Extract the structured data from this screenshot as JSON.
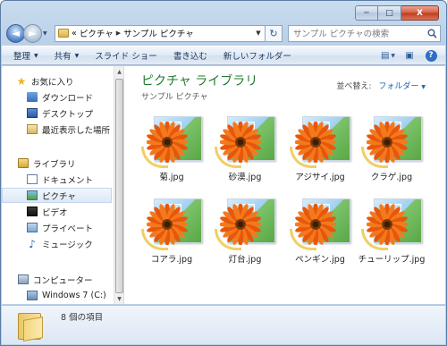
{
  "window": {
    "caption_min": "─",
    "caption_max": "□",
    "caption_close": "X"
  },
  "nav": {
    "back_icon": "left-arrow-icon",
    "forward_icon": "right-arrow-icon",
    "breadcrumb": [
      "«",
      "ピクチャ",
      "サンプル ピクチャ"
    ],
    "search_placeholder": "サンプル ピクチャの検索"
  },
  "toolbar": {
    "organize": "整理",
    "share": "共有",
    "slideshow": "スライド ショー",
    "burn": "書き込む",
    "new_folder": "新しいフォルダー"
  },
  "sidebar": {
    "favorites": {
      "label": "お気に入り",
      "items": [
        "ダウンロード",
        "デスクトップ",
        "最近表示した場所"
      ]
    },
    "libraries": {
      "label": "ライブラリ",
      "items": [
        "ドキュメント",
        "ピクチャ",
        "ビデオ",
        "プライベート",
        "ミュージック"
      ]
    },
    "computer": {
      "label": "コンピューター",
      "items": [
        "Windows 7 (C:)"
      ]
    }
  },
  "library": {
    "title": "ピクチャ ライブラリ",
    "subtitle": "サンプル ピクチャ",
    "arrange_label": "並べ替え:",
    "arrange_value": "フォルダー"
  },
  "files": [
    {
      "name": "菊.jpg"
    },
    {
      "name": "砂漠.jpg"
    },
    {
      "name": "アジサイ.jpg"
    },
    {
      "name": "クラゲ.jpg"
    },
    {
      "name": "コアラ.jpg"
    },
    {
      "name": "灯台.jpg"
    },
    {
      "name": "ペンギン.jpg"
    },
    {
      "name": "チューリップ.jpg"
    }
  ],
  "status": {
    "item_count": "8 個の項目"
  },
  "colors": {
    "library_title": "#1e7a2e",
    "link_blue": "#1d5fb0",
    "flower_orange": "#f06a12"
  }
}
